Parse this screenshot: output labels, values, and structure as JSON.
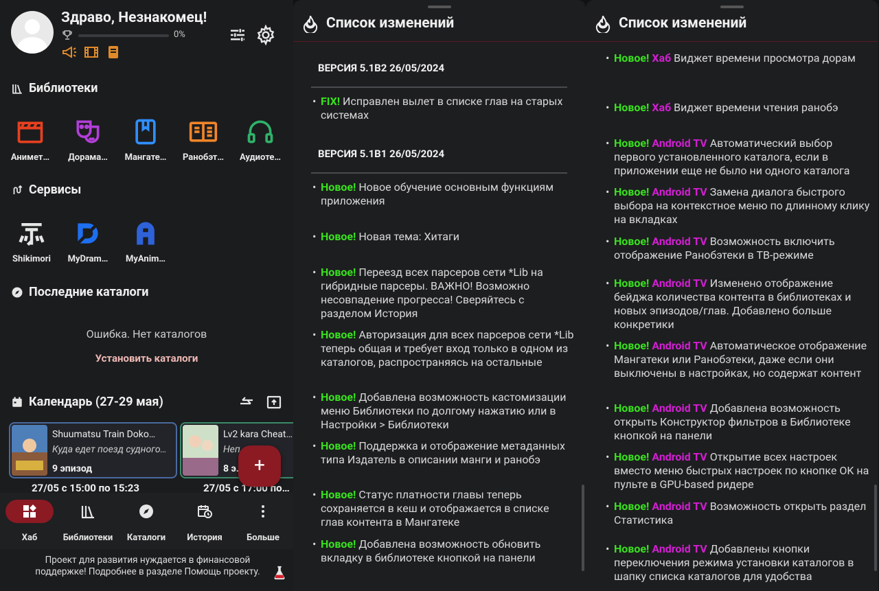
{
  "hub": {
    "greeting": "Здраво, Незнакомец!",
    "progress_percent": "0%",
    "progress_fraction": 0.0,
    "libraries_title": "Библиотеки",
    "libraries": [
      {
        "label": "Анимет…",
        "icon": "clapperboard-icon",
        "color": "#e8401f"
      },
      {
        "label": "Дорама…",
        "icon": "theater-masks-icon",
        "color": "#b13fd8"
      },
      {
        "label": "Мангате…",
        "icon": "bookmark-book-icon",
        "color": "#2f8fff"
      },
      {
        "label": "Ранобэт…",
        "icon": "open-book-icon",
        "color": "#f0852a"
      },
      {
        "label": "Аудиоте…",
        "icon": "headphones-icon",
        "color": "#2fb26a"
      }
    ],
    "services_title": "Сервисы",
    "services": [
      {
        "label": "Shikimori",
        "icon": "shikimori-logo-icon"
      },
      {
        "label": "MyDram…",
        "icon": "mydramalist-logo-icon"
      },
      {
        "label": "MyAnim…",
        "icon": "myanimelist-logo-icon"
      }
    ],
    "catalogs_title": "Последние каталоги",
    "catalogs_empty": "Ошибка. Нет каталогов",
    "install_catalogs": "Установить каталоги",
    "calendar_title": "Календарь (27-29 мая)",
    "calendar": [
      {
        "title": "Shuumatsu Train Doko…",
        "subtitle": "Куда едет поезд судного…",
        "episode": "9 эпизод",
        "time": "27/05 с 15:00 по 15:23"
      },
      {
        "title": "Lv2 kara Cheat…",
        "subtitle": "Неп… …ённ…",
        "episode": "8 э…",
        "time": "27/05 с 17:00 по…"
      }
    ],
    "fab_label": "+",
    "nav": [
      {
        "label": "Хаб",
        "icon": "hub-grid-icon",
        "active": true
      },
      {
        "label": "Библиотеки",
        "icon": "library-books-icon",
        "active": false
      },
      {
        "label": "Каталоги",
        "icon": "compass-icon",
        "active": false
      },
      {
        "label": "История",
        "icon": "history-calendar-icon",
        "active": false
      },
      {
        "label": "Больше",
        "icon": "more-vertical-icon",
        "active": false
      }
    ],
    "donate_text": "Проект для развития нуждается в финансовой поддержке! Подробнее в разделе Помощь проекту."
  },
  "changelog_left": {
    "title": "Список изменений",
    "versions": [
      {
        "header": "ВЕРСИЯ 5.1В2  26/05/2024",
        "entries": [
          {
            "tag": "FIX!",
            "platform": "",
            "text": "Исправлен вылет в списке глав на старых системах"
          }
        ]
      },
      {
        "header": "ВЕРСИЯ 5.1В1  26/05/2024",
        "entries": [
          {
            "tag": "Новое!",
            "platform": "",
            "text": "Новое обучение основным функциям приложения"
          },
          {
            "tag": "Новое!",
            "platform": "",
            "text": "Новая тема: Хитаги"
          },
          {
            "tag": "Новое!",
            "platform": "",
            "text": "Переезд всех парсеров сети *Lib на гибридные парсеры. ВАЖНО! Возможно несовпадение прогресса! Сверяйтесь с разделом История"
          },
          {
            "tag": "Новое!",
            "platform": "",
            "text": "Авторизация для всех парсеров сети *Lib теперь общая и требует вход только в одном из каталогов, распространяясь на остальные"
          },
          {
            "tag": "Новое!",
            "platform": "",
            "text": "Добавлена возможность кастомизации меню Библиотеки по долгому нажатию или в Настройки > Библиотеки"
          },
          {
            "tag": "Новое!",
            "platform": "",
            "text": "Поддержка и отображение метаданных типа Издатель в описании манги и ранобэ"
          },
          {
            "tag": "Новое!",
            "platform": "",
            "text": "Статус платности главы теперь сохраняется в кеш и отображается в списке глав контента в Мангатеке"
          },
          {
            "tag": "Новое!",
            "platform": "",
            "text": "Добавлена возможность обновить вкладку в библиотеке кнопкой на панели"
          }
        ]
      }
    ]
  },
  "changelog_right": {
    "title": "Список изменений",
    "entries": [
      {
        "tag": "Новое!",
        "platform": "Хаб",
        "text": "Виджет времени просмотра дорам"
      },
      {
        "tag": "Новое!",
        "platform": "Хаб",
        "text": "Виджет времени чтения ранобэ"
      },
      {
        "tag": "Новое!",
        "platform": "Android TV",
        "text": "Автоматический выбор первого установленного каталога, если в приложении еще не было ни одного каталога"
      },
      {
        "tag": "Новое!",
        "platform": "Android TV",
        "text": "Замена диалога быстрого выбора на контекстное меню по длинному клику на вкладках"
      },
      {
        "tag": "Новое!",
        "platform": "Android TV",
        "text": "Возможность включить отображение Ранобэтеки в ТВ-режиме"
      },
      {
        "tag": "Новое!",
        "platform": "Android TV",
        "text": "Изменено отображение бейджа количества контента в библиотеках и новых эпизодов/глав. Добавлено больше конкретики"
      },
      {
        "tag": "Новое!",
        "platform": "Android TV",
        "text": "Автоматическое отображение Мангатеки или Ранобэтеки, даже если они выключены в настройках, но содержат контент"
      },
      {
        "tag": "Новое!",
        "platform": "Android TV",
        "text": "Добавлена возможность открыть Конструктор фильтров в Библиотеке кнопкой на панели"
      },
      {
        "tag": "Новое!",
        "platform": "Android TV",
        "text": "Открытие всех настроек вместо меню быстрых настроек по кнопке OK на пульте в GPU-based ридере"
      },
      {
        "tag": "Новое!",
        "platform": "Android TV",
        "text": "Возможность открыть раздел Статистика"
      },
      {
        "tag": "Новое!",
        "platform": "Android TV",
        "text": "Добавлены кнопки переключения режима установки каталогов в шапку списка каталогов для удобства"
      }
    ]
  },
  "colors": {
    "new_tag": "#39e11f",
    "platform_tag": "#d21fd2",
    "accent": "#8b1a23",
    "link": "#f0b8b4"
  }
}
